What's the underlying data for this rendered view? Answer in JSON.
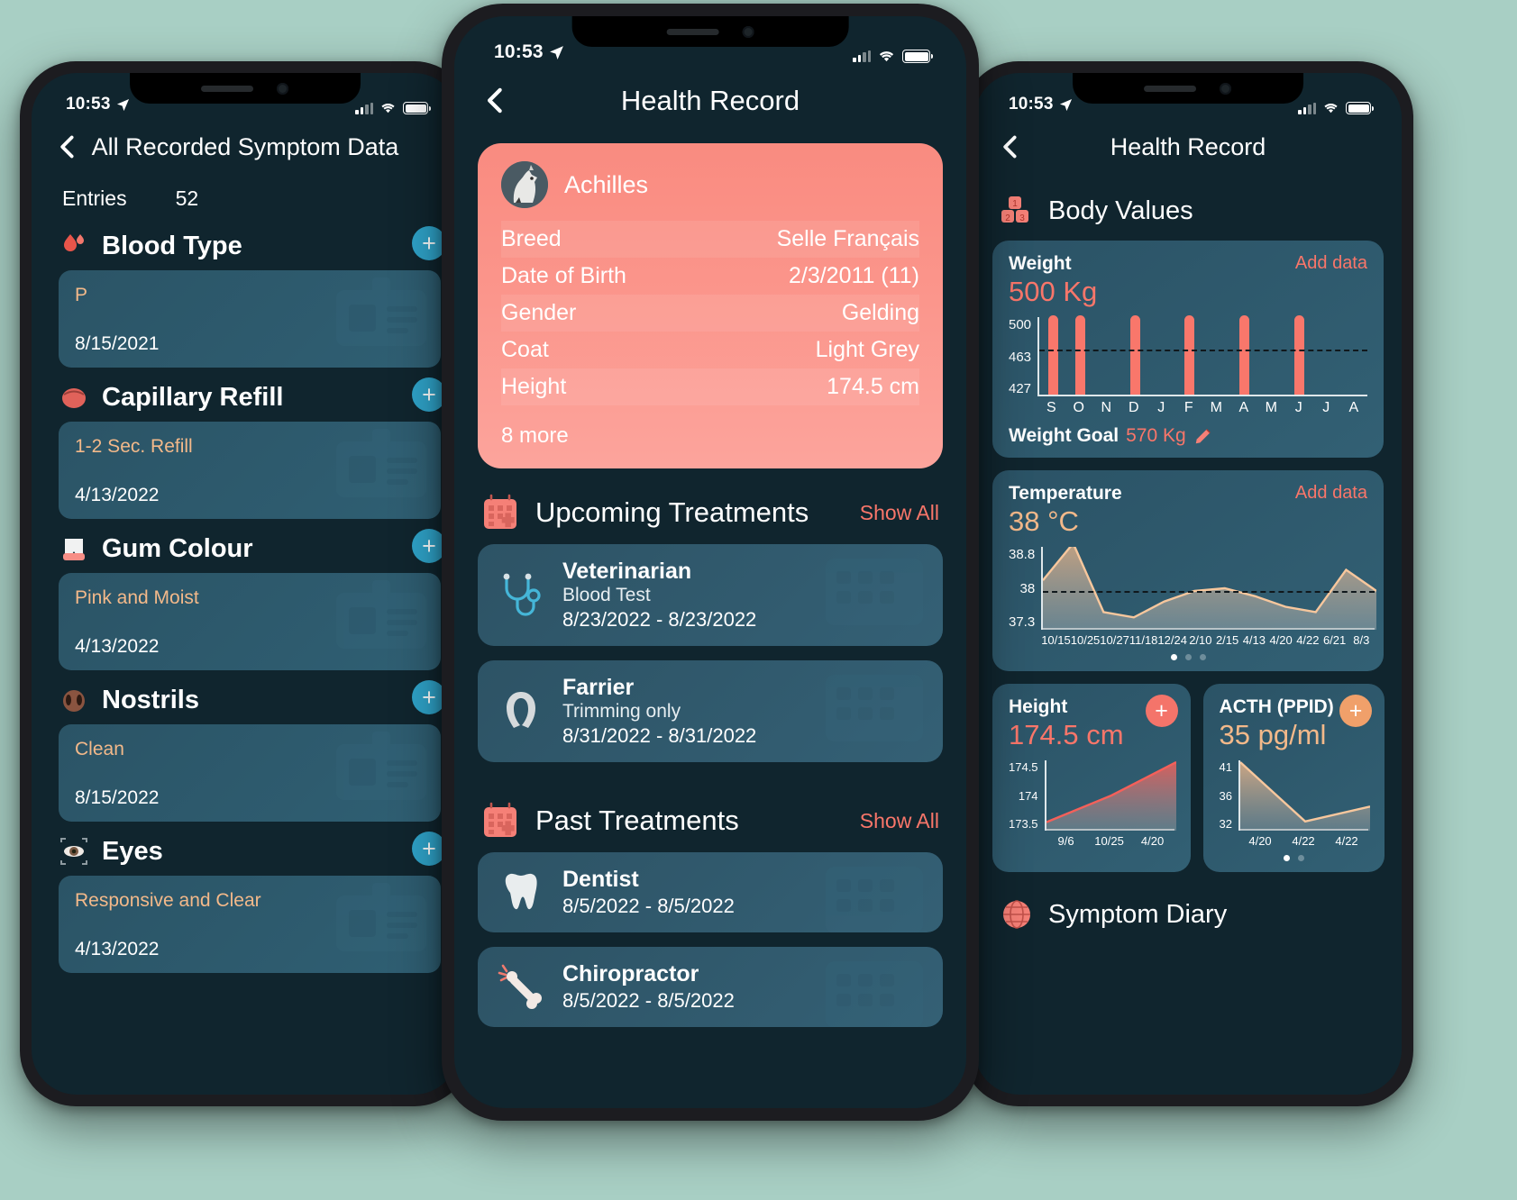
{
  "status_bar": {
    "time": "10:53",
    "location_icon": "location-arrow-icon",
    "signal_icon": "cellular-signal-icon",
    "wifi_icon": "wifi-icon",
    "battery_icon": "battery-icon"
  },
  "left_phone": {
    "nav": {
      "back_icon": "chevron-left-icon",
      "title": "All Recorded Symptom Data"
    },
    "entries": {
      "label": "Entries",
      "count": "52"
    },
    "add_icon": "plus-icon",
    "symptoms": [
      {
        "emoji": "blood-drop-icon",
        "name": "Blood Type",
        "value": "P",
        "date": "8/15/2021"
      },
      {
        "emoji": "capillary-icon",
        "name": "Capillary Refill",
        "value": "1-2 Sec. Refill",
        "date": "4/13/2022"
      },
      {
        "emoji": "tooth-gum-icon",
        "name": "Gum Colour",
        "value": "Pink and Moist",
        "date": "4/13/2022"
      },
      {
        "emoji": "nostrils-icon",
        "name": "Nostrils",
        "value": "Clean",
        "date": "8/15/2022"
      },
      {
        "emoji": "eye-icon",
        "name": "Eyes",
        "value": "Responsive and Clear",
        "date": "4/13/2022"
      }
    ]
  },
  "center_phone": {
    "nav": {
      "back_icon": "chevron-left-icon",
      "title": "Health Record"
    },
    "profile": {
      "avatar_icon": "horse-avatar",
      "name": "Achilles",
      "rows": [
        {
          "label": "Breed",
          "value": "Selle Français"
        },
        {
          "label": "Date of Birth",
          "value": "2/3/2011 (11)"
        },
        {
          "label": "Gender",
          "value": "Gelding"
        },
        {
          "label": "Coat",
          "value": "Light Grey"
        },
        {
          "label": "Height",
          "value": "174.5 cm"
        }
      ],
      "more": "8 more"
    },
    "upcoming": {
      "emoji": "calendar-medical-icon",
      "title": "Upcoming Treatments",
      "show_all": "Show All",
      "items": [
        {
          "icon": "stethoscope-icon",
          "title": "Veterinarian",
          "sub": "Blood Test",
          "date": "8/23/2022 - 8/23/2022"
        },
        {
          "icon": "horseshoe-icon",
          "title": "Farrier",
          "sub": "Trimming only",
          "date": "8/31/2022 - 8/31/2022"
        }
      ]
    },
    "past": {
      "emoji": "calendar-medical-icon",
      "title": "Past Treatments",
      "show_all": "Show All",
      "items": [
        {
          "icon": "tooth-icon",
          "title": "Dentist",
          "sub": "",
          "date": "8/5/2022 - 8/5/2022"
        },
        {
          "icon": "bone-icon",
          "title": "Chiropractor",
          "sub": "",
          "date": "8/5/2022 - 8/5/2022"
        }
      ]
    }
  },
  "right_phone": {
    "nav": {
      "back_icon": "chevron-left-icon",
      "title": "Health Record"
    },
    "body_values": {
      "emoji": "number-blocks-icon",
      "title": "Body Values"
    },
    "weight": {
      "label": "Weight",
      "value": "500 Kg",
      "add_data": "Add data",
      "goal_label": "Weight Goal",
      "goal_value": "570 Kg",
      "edit_icon": "pencil-icon"
    },
    "temperature": {
      "label": "Temperature",
      "value": "38 °C",
      "add_data": "Add data"
    },
    "height": {
      "label": "Height",
      "value": "174.5 cm",
      "add_icon": "plus-icon"
    },
    "acth": {
      "label": "ACTH (PPID)",
      "value": "35 pg/ml",
      "add_icon": "plus-icon"
    },
    "symptom_diary": {
      "emoji": "globe-icon",
      "title": "Symptom Diary"
    }
  },
  "colors": {
    "accent_red": "#f9766a",
    "accent_orange": "#f3b98a",
    "card_blue": "#2f5c70",
    "screen_bg": "#10252e",
    "add_blue": "#2fa3c9"
  },
  "chart_data": [
    {
      "type": "bar",
      "title": "Weight",
      "ylabel": "Kg",
      "categories": [
        "S",
        "O",
        "N",
        "D",
        "J",
        "F",
        "M",
        "A",
        "M",
        "J",
        "J",
        "A"
      ],
      "values": [
        500,
        500,
        null,
        500,
        null,
        500,
        null,
        500,
        null,
        500,
        null,
        null
      ],
      "yticks": [
        500,
        463,
        427
      ],
      "ylim": [
        427,
        500
      ],
      "goal_line": 470,
      "grid": false,
      "legend": "none"
    },
    {
      "type": "area",
      "title": "Temperature",
      "ylabel": "°C",
      "categories": [
        "10/15",
        "10/25",
        "10/27",
        "11/18",
        "12/24",
        "2/10",
        "2/15",
        "4/13",
        "4/20",
        "4/22",
        "6/21",
        "8/3"
      ],
      "values": [
        38.2,
        38.9,
        37.6,
        37.5,
        37.8,
        38.0,
        38.05,
        37.9,
        37.7,
        37.6,
        38.4,
        38.0
      ],
      "yticks": [
        38.8,
        38.0,
        37.3
      ],
      "ylim": [
        37.3,
        38.8
      ],
      "goal_line": 38.0,
      "grid": false,
      "legend": "none"
    },
    {
      "type": "area",
      "title": "Height",
      "ylabel": "cm",
      "categories": [
        "9/6",
        "10/25",
        "4/20"
      ],
      "values": [
        173.6,
        174.0,
        174.5
      ],
      "yticks": [
        174.5,
        174.0,
        173.5
      ],
      "ylim": [
        173.5,
        174.5
      ],
      "grid": false,
      "legend": "none"
    },
    {
      "type": "area",
      "title": "ACTH (PPID)",
      "ylabel": "pg/ml",
      "categories": [
        "4/20",
        "4/22",
        "4/22"
      ],
      "values": [
        41,
        33,
        35
      ],
      "yticks": [
        41,
        36,
        32
      ],
      "ylim": [
        32,
        41
      ],
      "grid": false,
      "legend": "none"
    }
  ]
}
